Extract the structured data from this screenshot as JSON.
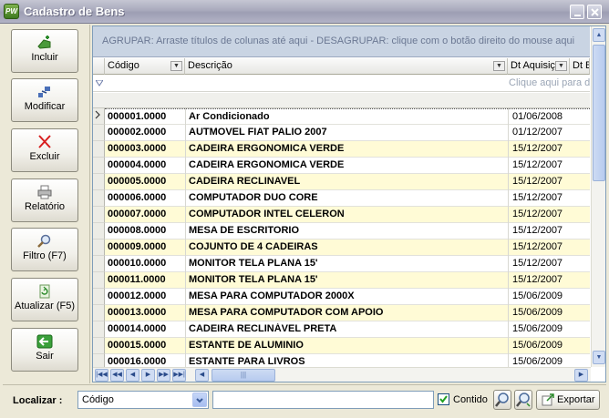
{
  "window": {
    "title": "Cadastro de Bens",
    "icon_text": "PW"
  },
  "sidebar": {
    "buttons": [
      {
        "label": "Incluir",
        "icon": "add-icon"
      },
      {
        "label": "Modificar",
        "icon": "modify-icon"
      },
      {
        "label": "Excluir",
        "icon": "delete-icon"
      },
      {
        "label": "Relatório",
        "icon": "printer-icon"
      },
      {
        "label": "Filtro (F7)",
        "icon": "magnifier-icon"
      },
      {
        "label": "Atualizar (F5)",
        "icon": "refresh-icon"
      },
      {
        "label": "Sair",
        "icon": "exit-icon"
      }
    ]
  },
  "grid": {
    "group_hint": "AGRUPAR: Arraste títulos de colunas até aqui - DESAGRUPAR: clique com o botão direito do mouse aqui",
    "columns": [
      "Código",
      "Descrição",
      "Dt Aquisição",
      "Dt B"
    ],
    "filter_hint": "Clique aqui para d",
    "rows": [
      {
        "codigo": "000001.0000",
        "descricao": "Ar Condicionado",
        "data": "01/06/2008"
      },
      {
        "codigo": "000002.0000",
        "descricao": "AUTMOVEL FIAT PALIO 2007",
        "data": "01/12/2007"
      },
      {
        "codigo": "000003.0000",
        "descricao": "CADEIRA ERGONOMICA VERDE",
        "data": "15/12/2007"
      },
      {
        "codigo": "000004.0000",
        "descricao": "CADEIRA ERGONOMICA VERDE",
        "data": "15/12/2007"
      },
      {
        "codigo": "000005.0000",
        "descricao": "CADEIRA RECLINAVEL",
        "data": "15/12/2007"
      },
      {
        "codigo": "000006.0000",
        "descricao": "COMPUTADOR DUO CORE",
        "data": "15/12/2007"
      },
      {
        "codigo": "000007.0000",
        "descricao": "COMPUTADOR INTEL CELERON",
        "data": "15/12/2007"
      },
      {
        "codigo": "000008.0000",
        "descricao": "MESA DE ESCRITORIO",
        "data": "15/12/2007"
      },
      {
        "codigo": "000009.0000",
        "descricao": "COJUNTO DE 4 CADEIRAS",
        "data": "15/12/2007"
      },
      {
        "codigo": "000010.0000",
        "descricao": "MONITOR TELA PLANA 15'",
        "data": "15/12/2007"
      },
      {
        "codigo": "000011.0000",
        "descricao": "MONITOR TELA PLANA 15'",
        "data": "15/12/2007"
      },
      {
        "codigo": "000012.0000",
        "descricao": "MESA PARA COMPUTADOR 2000X",
        "data": "15/06/2009"
      },
      {
        "codigo": "000013.0000",
        "descricao": "MESA PARA COMPUTADOR COM APOIO",
        "data": "15/06/2009"
      },
      {
        "codigo": "000014.0000",
        "descricao": "CADEIRA RECLINÁVEL PRETA",
        "data": "15/06/2009"
      },
      {
        "codigo": "000015.0000",
        "descricao": "ESTANTE DE ALUMINIO",
        "data": "15/06/2009"
      },
      {
        "codigo": "000016.0000",
        "descricao": "ESTANTE PARA LIVROS",
        "data": "15/06/2009"
      }
    ]
  },
  "search": {
    "label": "Localizar :",
    "field_value": "Código",
    "text_value": "",
    "contido_label": "Contido",
    "contido_checked": true,
    "export_label": "Exportar"
  },
  "colors": {
    "row_alt": "#fffbd6",
    "group_bar": "#c9d4e3",
    "title_bar": "#a9aabd"
  }
}
